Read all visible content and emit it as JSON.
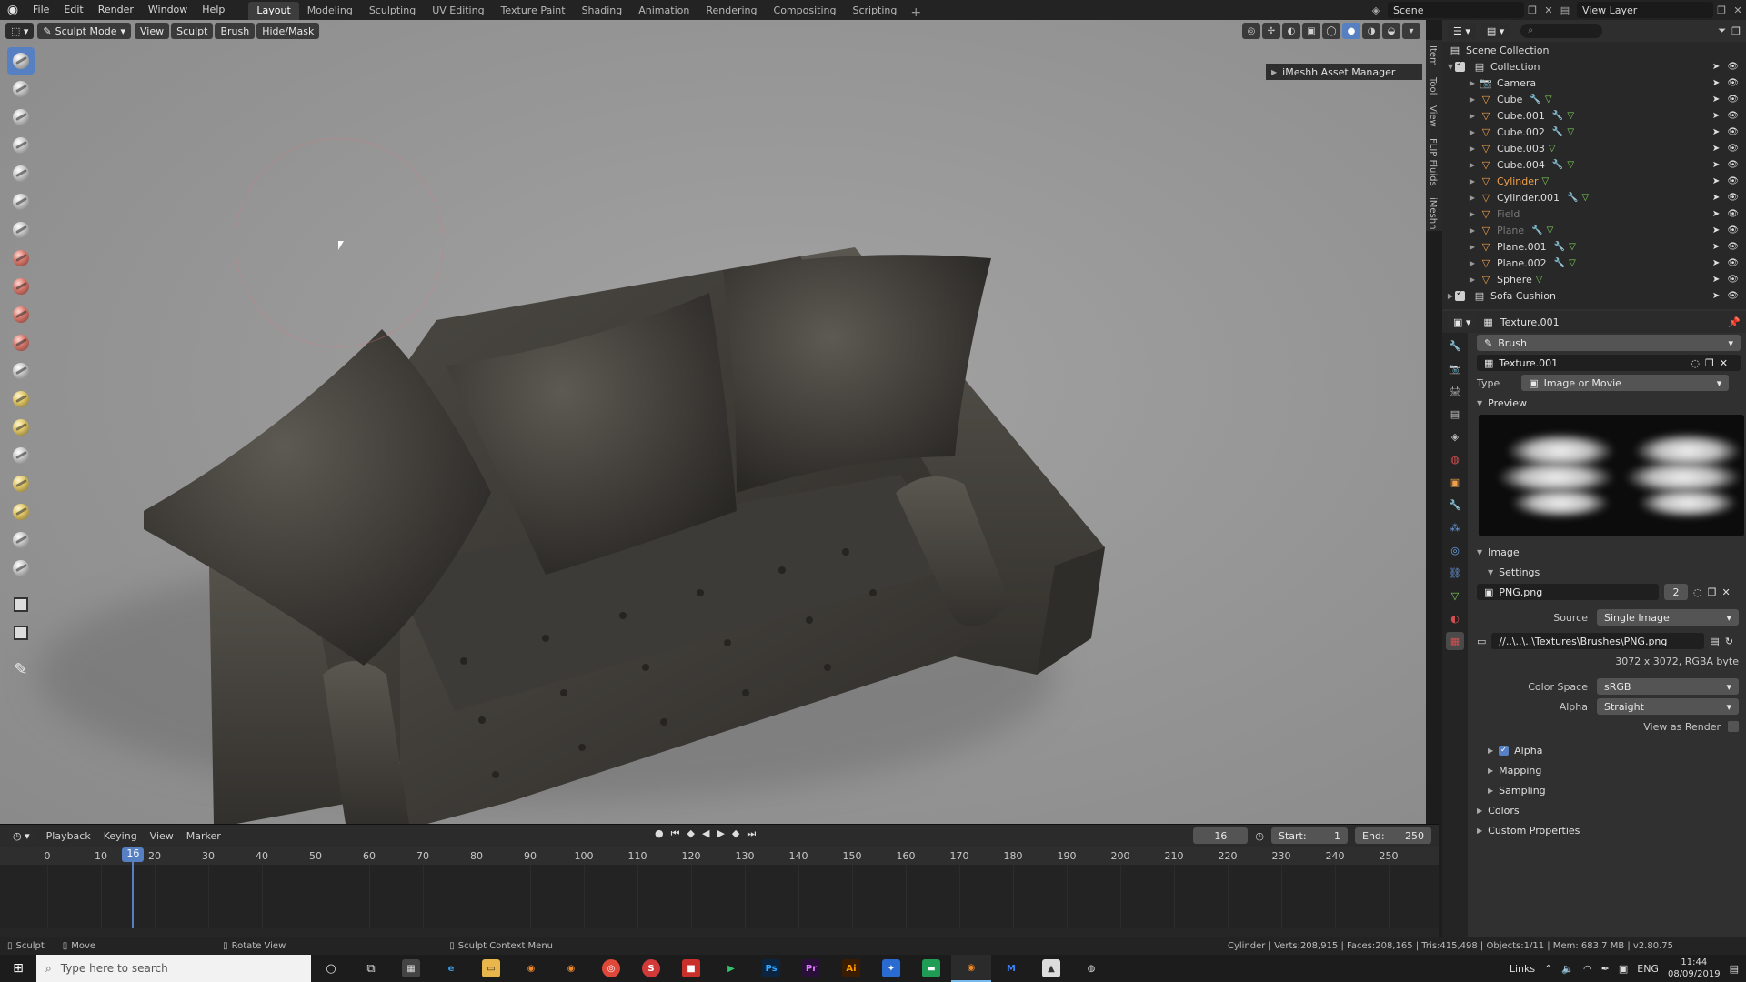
{
  "menubar": {
    "menus": [
      "File",
      "Edit",
      "Render",
      "Window",
      "Help"
    ],
    "workspaces": [
      "Layout",
      "Modeling",
      "Sculpting",
      "UV Editing",
      "Texture Paint",
      "Shading",
      "Animation",
      "Rendering",
      "Compositing",
      "Scripting"
    ],
    "active_workspace": "Layout",
    "add_workspace": "+",
    "scene": "Scene",
    "view_layer": "View Layer"
  },
  "viewport": {
    "mode": "Sculpt Mode",
    "menus": [
      "View",
      "Sculpt",
      "Brush",
      "Hide/Mask"
    ],
    "asset_manager": "iMeshh Asset Manager",
    "n_tabs": [
      "Item",
      "Tool",
      "View",
      "FLIP Fluids",
      "iMeshh"
    ]
  },
  "timeline": {
    "menus": [
      "Playback",
      "Keying",
      "View",
      "Marker"
    ],
    "current_frame": "16",
    "start_label": "Start:",
    "start": "1",
    "end_label": "End:",
    "end": "250",
    "ticks": [
      "0",
      "10",
      "20",
      "30",
      "40",
      "50",
      "60",
      "70",
      "80",
      "90",
      "100",
      "110",
      "120",
      "130",
      "140",
      "150",
      "160",
      "170",
      "180",
      "190",
      "200",
      "210",
      "220",
      "230",
      "240",
      "250"
    ],
    "playhead": "16"
  },
  "statusbar": {
    "left": [
      "Sculpt",
      "Move",
      "Rotate View",
      "Sculpt Context Menu"
    ],
    "stats": "Cylinder | Verts:208,915 | Faces:208,165 | Tris:415,498 | Objects:1/11 | Mem: 683.7 MB | v2.80.75"
  },
  "outliner": {
    "root": "Scene Collection",
    "collection": "Collection",
    "items": [
      {
        "name": "Camera",
        "dim": false,
        "sel": false,
        "mod": false,
        "mesh": false
      },
      {
        "name": "Cube",
        "dim": false,
        "sel": false,
        "mod": true,
        "mesh": true
      },
      {
        "name": "Cube.001",
        "dim": false,
        "sel": false,
        "mod": true,
        "mesh": true
      },
      {
        "name": "Cube.002",
        "dim": false,
        "sel": false,
        "mod": true,
        "mesh": true
      },
      {
        "name": "Cube.003",
        "dim": false,
        "sel": false,
        "mod": false,
        "mesh": true
      },
      {
        "name": "Cube.004",
        "dim": false,
        "sel": false,
        "mod": true,
        "mesh": true
      },
      {
        "name": "Cylinder",
        "dim": false,
        "sel": true,
        "mod": false,
        "mesh": true
      },
      {
        "name": "Cylinder.001",
        "dim": false,
        "sel": false,
        "mod": true,
        "mesh": true
      },
      {
        "name": "Field",
        "dim": true,
        "sel": false,
        "mod": false,
        "mesh": false
      },
      {
        "name": "Plane",
        "dim": true,
        "sel": false,
        "mod": true,
        "mesh": true
      },
      {
        "name": "Plane.001",
        "dim": false,
        "sel": false,
        "mod": true,
        "mesh": true
      },
      {
        "name": "Plane.002",
        "dim": false,
        "sel": false,
        "mod": true,
        "mesh": true
      },
      {
        "name": "Sphere",
        "dim": false,
        "sel": false,
        "mod": false,
        "mesh": true
      }
    ],
    "collection2": "Sofa Cushion"
  },
  "properties": {
    "header_title": "Texture.001",
    "brush_label": "Brush",
    "texture_name": "Texture.001",
    "type_label": "Type",
    "type_value": "Image or Movie",
    "preview_label": "Preview",
    "image_label": "Image",
    "settings_label": "Settings",
    "image_file": "PNG.png",
    "image_users": "2",
    "source_label": "Source",
    "source_value": "Single Image",
    "path": "//..\\..\\..\\Textures\\Brushes\\PNG.png",
    "resolution": "3072 x 3072,  RGBA byte",
    "color_space_label": "Color Space",
    "color_space_value": "sRGB",
    "alpha_label": "Alpha",
    "alpha_value": "Straight",
    "view_as_render": "View as Render",
    "sub_alpha": "Alpha",
    "sub_mapping": "Mapping",
    "sub_sampling": "Sampling",
    "colors": "Colors",
    "custom_props": "Custom Properties"
  },
  "taskbar": {
    "search_placeholder": "Type here to search",
    "links": "Links",
    "lang": "ENG",
    "time": "11:44",
    "date": "08/09/2019"
  },
  "colors": {
    "accent": "#5680c2",
    "object_orange": "#f0a04a",
    "mesh_green": "#7fd35a",
    "modifier_blue": "#6aa2e8"
  }
}
